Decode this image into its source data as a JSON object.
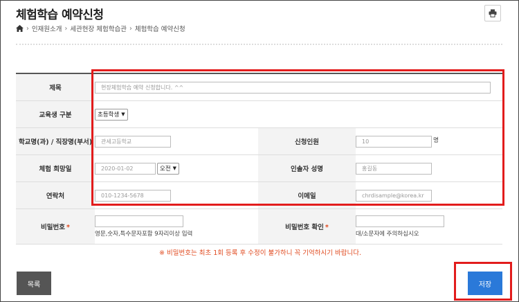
{
  "page": {
    "title": "체험학습 예약신청",
    "breadcrumbs": [
      "인재원소개",
      "세관현장 체험학습관",
      "체험학습 예약신청"
    ]
  },
  "form": {
    "subject": {
      "label": "제목",
      "placeholder": "현장체험학습 예약 신청합니다. ^^"
    },
    "student_type": {
      "label": "교육생 구분",
      "value": "초등학생"
    },
    "school": {
      "label": "학교명(과) / 직장명(부서)",
      "placeholder": "관세고등학교"
    },
    "applicants": {
      "label": "신청인원",
      "placeholder": "10",
      "unit": "명"
    },
    "visit_date": {
      "label": "체험 희망일",
      "placeholder": "2020-01-02",
      "time_value": "오전"
    },
    "leader": {
      "label": "인솔자 성명",
      "placeholder": "홍길동"
    },
    "phone": {
      "label": "연락처",
      "placeholder": "010-1234-5678"
    },
    "email": {
      "label": "이메일",
      "placeholder": "chrdisample@korea.kr"
    },
    "password": {
      "label": "비밀번호",
      "required_mark": "*",
      "hint": "영문,숫자,특수문자포함 9자리이상 입력"
    },
    "password_confirm": {
      "label": "비밀번호 확인",
      "required_mark": "*",
      "hint": "대/소문자에 주의하십시오"
    }
  },
  "notice": "※ 비밀번호는 최초 1회 등록 후 수정이 불가하니 꼭 기억하시기 바랍니다.",
  "buttons": {
    "list": "목록",
    "save": "저장"
  },
  "colors": {
    "accent": "#2a79d9",
    "highlight": "#e21c1c",
    "notice": "#e04a1f"
  },
  "icons": {
    "print": "printer-icon",
    "home": "home-icon"
  }
}
